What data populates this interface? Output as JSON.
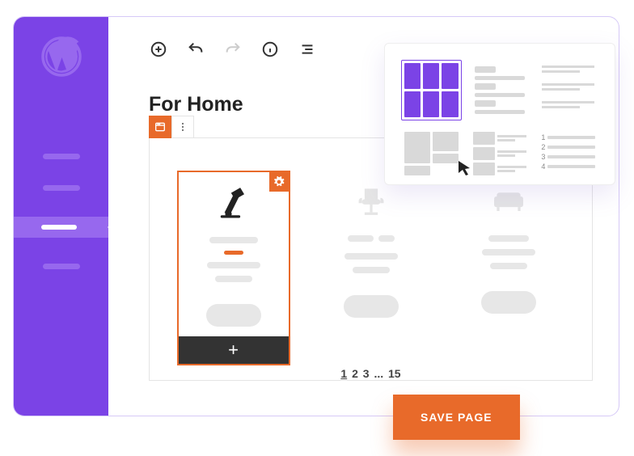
{
  "page": {
    "title": "For Home"
  },
  "toolbar": {
    "add": "plus-icon",
    "undo": "undo-icon",
    "redo": "redo-icon",
    "info": "info-icon",
    "outline": "outline-icon"
  },
  "block": {
    "add_label": "+",
    "cards": [
      {
        "name": "lamp",
        "selected": true
      },
      {
        "name": "chair",
        "selected": false
      },
      {
        "name": "sofa",
        "selected": false
      }
    ]
  },
  "pagination": {
    "current": "1",
    "p2": "2",
    "p3": "3",
    "ellipsis": "...",
    "last": "15"
  },
  "layout_picker": {
    "options": [
      "grid",
      "list",
      "text",
      "masonry",
      "image-text",
      "numbered"
    ],
    "selected": "grid",
    "numbered": {
      "n1": "1",
      "n2": "2",
      "n3": "3",
      "n4": "4"
    }
  },
  "save_button": {
    "label": "SAVE PAGE"
  }
}
